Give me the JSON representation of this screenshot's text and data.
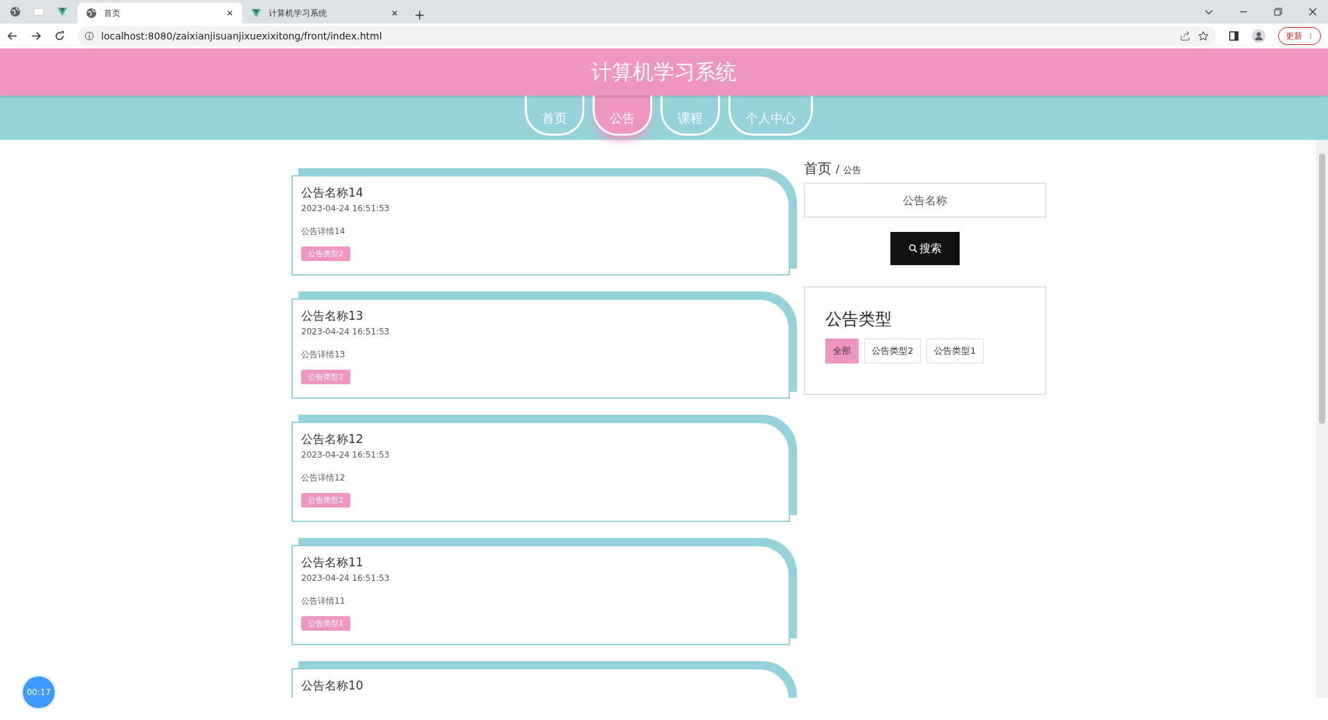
{
  "browser": {
    "tabs": [
      {
        "title": "首页",
        "selected": true
      },
      {
        "title": "计算机学习系统",
        "selected": false
      }
    ],
    "url": "localhost:8080/zaixianjisuanjixuexixitong/front/index.html",
    "update_button": "更新"
  },
  "header": {
    "title": "计算机学习系统"
  },
  "nav": [
    {
      "label": "首页",
      "selected": false
    },
    {
      "label": "公告",
      "selected": true
    },
    {
      "label": "课程",
      "selected": false
    },
    {
      "label": "个人中心",
      "selected": false
    }
  ],
  "notices": [
    {
      "title": "公告名称14",
      "time": "2023-04-24 16:51:53",
      "detail": "公告详情14",
      "tag": "公告类型2"
    },
    {
      "title": "公告名称13",
      "time": "2023-04-24 16:51:53",
      "detail": "公告详情13",
      "tag": "公告类型2"
    },
    {
      "title": "公告名称12",
      "time": "2023-04-24 16:51:53",
      "detail": "公告详情12",
      "tag": "公告类型2"
    },
    {
      "title": "公告名称11",
      "time": "2023-04-24 16:51:53",
      "detail": "公告详情11",
      "tag": "公告类型1"
    },
    {
      "title": "公告名称10"
    }
  ],
  "breadcrumb": {
    "home": "首页",
    "separator": "/",
    "current": "公告"
  },
  "search": {
    "placeholder": "公告名称",
    "button": "搜索"
  },
  "types": {
    "heading": "公告类型",
    "items": [
      {
        "label": "全部",
        "selected": true
      },
      {
        "label": "公告类型2",
        "selected": false
      },
      {
        "label": "公告类型1",
        "selected": false
      }
    ]
  },
  "timer": "00:17"
}
